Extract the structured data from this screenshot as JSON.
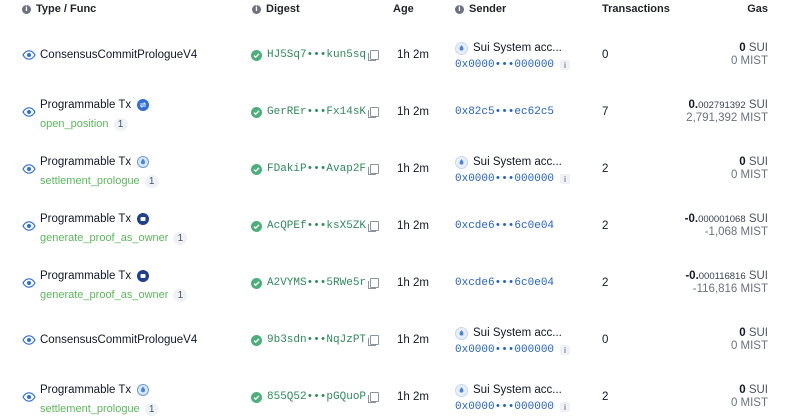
{
  "columns": {
    "type": "Type / Func",
    "digest": "Digest",
    "age": "Age",
    "sender": "Sender",
    "transactions": "Transactions",
    "gas": "Gas"
  },
  "rows": [
    {
      "type": "ConsensusCommitPrologueV4",
      "func": "",
      "func_count": "",
      "protocol_icon": "",
      "digest": "HJ5Sq7•••kun5sq",
      "age": "1h 2m",
      "sender_name": "Sui System acc...",
      "sender_addr": "0x0000•••000000",
      "transactions": "0",
      "gas_int": "0",
      "gas_frac": "",
      "gas_unit": "SUI",
      "gas_mist": "0 MIST"
    },
    {
      "type": "Programmable Tx",
      "func": "open_position",
      "func_count": "1",
      "protocol_icon": "exchange-icon",
      "digest": "GerREr•••Fx14sK",
      "age": "1h 2m",
      "sender_name": "",
      "sender_addr": "0x82c5•••ec62c5",
      "transactions": "7",
      "gas_int": "0.",
      "gas_frac": "002791392",
      "gas_unit": "SUI",
      "gas_mist": "2,791,392 MIST"
    },
    {
      "type": "Programmable Tx",
      "func": "settlement_prologue",
      "func_count": "1",
      "protocol_icon": "sui-icon",
      "digest": "FDakiP•••Avap2F",
      "age": "1h 2m",
      "sender_name": "Sui System acc...",
      "sender_addr": "0x0000•••000000",
      "transactions": "2",
      "gas_int": "0",
      "gas_frac": "",
      "gas_unit": "SUI",
      "gas_mist": "0 MIST"
    },
    {
      "type": "Programmable Tx",
      "func": "generate_proof_as_owner",
      "func_count": "1",
      "protocol_icon": "app-icon",
      "digest": "AcQPEf•••ksX5ZK",
      "age": "1h 2m",
      "sender_name": "",
      "sender_addr": "0xcde6•••6c0e04",
      "transactions": "2",
      "gas_int": "-0.",
      "gas_frac": "000001068",
      "gas_unit": "SUI",
      "gas_mist": "-1,068 MIST"
    },
    {
      "type": "Programmable Tx",
      "func": "generate_proof_as_owner",
      "func_count": "1",
      "protocol_icon": "app-icon",
      "digest": "A2VYMS•••5RWe5r",
      "age": "1h 2m",
      "sender_name": "",
      "sender_addr": "0xcde6•••6c0e04",
      "transactions": "2",
      "gas_int": "-0.",
      "gas_frac": "000116816",
      "gas_unit": "SUI",
      "gas_mist": "-116,816 MIST"
    },
    {
      "type": "ConsensusCommitPrologueV4",
      "func": "",
      "func_count": "",
      "protocol_icon": "",
      "digest": "9b3sdn•••NqJzPT",
      "age": "1h 2m",
      "sender_name": "Sui System acc...",
      "sender_addr": "0x0000•••000000",
      "transactions": "0",
      "gas_int": "0",
      "gas_frac": "",
      "gas_unit": "SUI",
      "gas_mist": "0 MIST"
    },
    {
      "type": "Programmable Tx",
      "func": "settlement_prologue",
      "func_count": "1",
      "protocol_icon": "sui-icon",
      "digest": "855Q52•••pGQuoP",
      "age": "1h 2m",
      "sender_name": "Sui System acc...",
      "sender_addr": "0x0000•••000000",
      "transactions": "2",
      "gas_int": "0",
      "gas_frac": "",
      "gas_unit": "SUI",
      "gas_mist": "0 MIST"
    }
  ],
  "colors": {
    "func_green": "#5cb85c",
    "digest_green": "#2f8a5c",
    "address_blue": "#2563c9"
  }
}
